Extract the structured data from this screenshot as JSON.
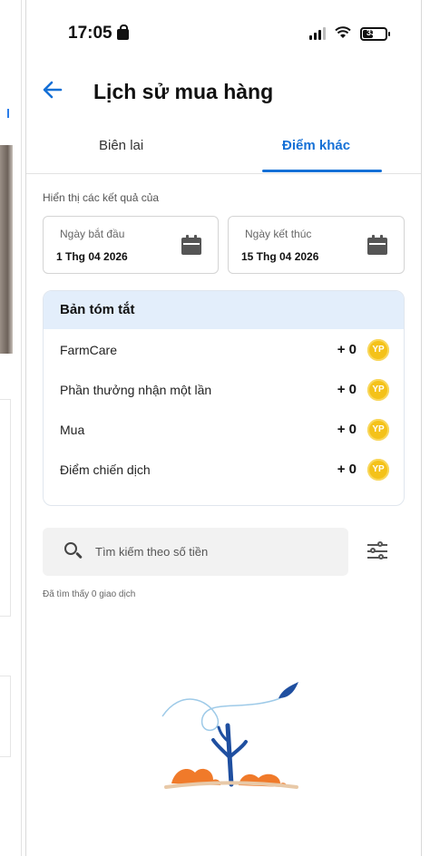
{
  "status_bar": {
    "time": "17:05",
    "battery": "33"
  },
  "header": {
    "title": "Lịch sử mua hàng"
  },
  "tabs": [
    {
      "label": "Biên lai",
      "active": false
    },
    {
      "label": "Điểm khác",
      "active": true
    }
  ],
  "filter_section": {
    "label": "Hiển thị các kết quả của",
    "start": {
      "label": "Ngày bắt đầu",
      "value": "1 Thg 04 2026"
    },
    "end": {
      "label": "Ngày kết thúc",
      "value": "15 Thg 04 2026"
    }
  },
  "summary": {
    "title": "Bản tóm tắt",
    "coin_label": "YP",
    "rows": [
      {
        "name": "FarmCare",
        "points": "+ 0"
      },
      {
        "name": "Phần thưởng nhận một lần",
        "points": "+ 0"
      },
      {
        "name": "Mua",
        "points": "+ 0"
      },
      {
        "name": "Điểm chiến dịch",
        "points": "+ 0"
      }
    ]
  },
  "search": {
    "placeholder": "Tìm kiếm theo số tiền"
  },
  "result_text": "Đã tìm thấy 0 giao dịch",
  "colors": {
    "accent": "#1570d6",
    "summary_header": "#e3eefb",
    "coin": "#f4c21a",
    "plant_orange": "#f07a2a",
    "plant_blue": "#1f4fa0"
  },
  "icons": [
    "lock-icon",
    "signal-icon",
    "wifi-icon",
    "battery-icon",
    "back-arrow-icon",
    "calendar-icon",
    "coin-icon",
    "search-icon",
    "filter-icon"
  ]
}
